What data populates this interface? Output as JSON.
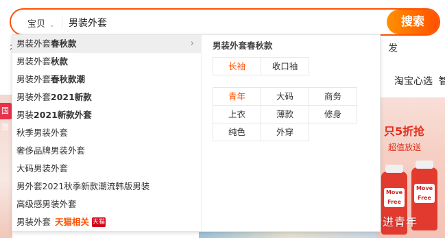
{
  "search": {
    "category": "宝贝",
    "query": "男装外套",
    "button_label": "搜索"
  },
  "background": {
    "partial_left": "衤",
    "partial_right": "发",
    "nav_text": "淘宝心选",
    "nav_text_end": "智",
    "left_tag": "国货",
    "promo_title": "只5折抢",
    "promo_sub": "超值放送",
    "bottle_label": "Move Free",
    "watermark": "知乎 @精进青年"
  },
  "suggestions": [
    {
      "prefix": "男装外套",
      "suffix": "春秋款",
      "active": true
    },
    {
      "prefix": "男装外套",
      "suffix": "秋款"
    },
    {
      "prefix": "男装外套",
      "suffix": "春秋款潮"
    },
    {
      "prefix": "男装外套",
      "suffix": "2021新款"
    },
    {
      "prefix": "男装",
      "suffix": "2021新款外套"
    },
    {
      "prefix": "",
      "suffix": "秋季男装外套"
    },
    {
      "prefix": "",
      "suffix": "奢侈品牌男装外套"
    },
    {
      "prefix": "",
      "suffix": "大码男装外套"
    },
    {
      "prefix": "",
      "suffix": "男外套2021秋季新款潮流韩版男装"
    },
    {
      "prefix": "",
      "suffix": "高级感男装外套"
    },
    {
      "prefix": "男装外套",
      "suffix": "",
      "tmall_label": "天猫相关",
      "tmall_badge": "天猫"
    }
  ],
  "panel": {
    "title": "男装外套春秋款",
    "group1": [
      "长袖",
      "收口袖"
    ],
    "group2": [
      "青年",
      "大码",
      "商务",
      "上衣",
      "薄款",
      "修身",
      "纯色",
      "外穿"
    ]
  },
  "colors": {
    "accent": "#ff5000",
    "accent_light": "#ff9000",
    "tmall_red": "#d0021b"
  }
}
